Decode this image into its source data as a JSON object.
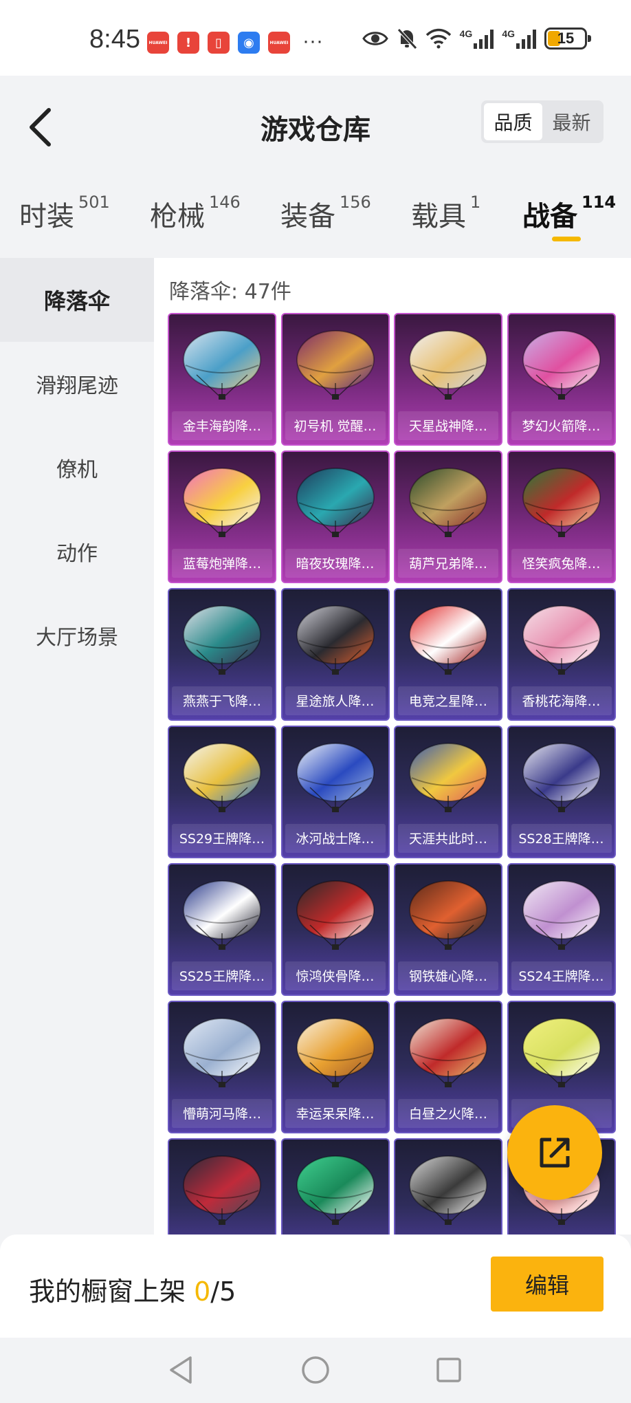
{
  "status_bar": {
    "time": "8:45",
    "notifications": [
      {
        "icon": "huawei-app-icon",
        "color": "red",
        "text": "HUAWEI"
      },
      {
        "icon": "alert-app-icon",
        "color": "red",
        "text": "!"
      },
      {
        "icon": "book-app-icon",
        "color": "red",
        "text": "▯"
      },
      {
        "icon": "bulb-app-icon",
        "color": "blue",
        "text": "◉"
      },
      {
        "icon": "huawei-app-icon",
        "color": "red",
        "text": "HUAWEI"
      }
    ],
    "more": "···",
    "signal_1": "4G",
    "signal_2": "4G",
    "battery": "15"
  },
  "header": {
    "title": "游戏仓库",
    "sort_options": [
      "品质",
      "最新"
    ],
    "active_sort": 0
  },
  "tabs": [
    {
      "label": "时装",
      "count": "501"
    },
    {
      "label": "枪械",
      "count": "146"
    },
    {
      "label": "装备",
      "count": "156"
    },
    {
      "label": "载具",
      "count": "1"
    },
    {
      "label": "战备",
      "count": "114"
    }
  ],
  "active_tab": 4,
  "sidebar": {
    "items": [
      "降落伞",
      "滑翔尾迹",
      "僚机",
      "动作",
      "大厅场景"
    ],
    "active": 0
  },
  "content": {
    "count_label": "降落伞: 47件",
    "items": [
      {
        "name": "金丰海韵降…",
        "tier": "purple"
      },
      {
        "name": "初号机 觉醒…",
        "tier": "purple"
      },
      {
        "name": "天星战神降…",
        "tier": "purple"
      },
      {
        "name": "梦幻火箭降…",
        "tier": "purple"
      },
      {
        "name": "蓝莓炮弹降…",
        "tier": "purple"
      },
      {
        "name": "暗夜玫瑰降…",
        "tier": "purple"
      },
      {
        "name": "葫芦兄弟降…",
        "tier": "purple"
      },
      {
        "name": "怪笑疯兔降…",
        "tier": "purple"
      },
      {
        "name": "燕燕于飞降…",
        "tier": "blue"
      },
      {
        "name": "星途旅人降…",
        "tier": "blue"
      },
      {
        "name": "电竞之星降…",
        "tier": "blue"
      },
      {
        "name": "香桃花海降…",
        "tier": "blue"
      },
      {
        "name": "SS29王牌降…",
        "tier": "blue"
      },
      {
        "name": "冰河战士降…",
        "tier": "blue"
      },
      {
        "name": "天涯共此时…",
        "tier": "blue"
      },
      {
        "name": "SS28王牌降…",
        "tier": "blue"
      },
      {
        "name": "SS25王牌降…",
        "tier": "blue"
      },
      {
        "name": "惊鸿侠骨降…",
        "tier": "blue"
      },
      {
        "name": "钢铁雄心降…",
        "tier": "blue"
      },
      {
        "name": "SS24王牌降…",
        "tier": "blue"
      },
      {
        "name": "懵萌河马降…",
        "tier": "blue"
      },
      {
        "name": "幸运呆呆降…",
        "tier": "blue"
      },
      {
        "name": "白昼之火降…",
        "tier": "blue"
      },
      {
        "name": "日…降…",
        "tier": "blue"
      },
      {
        "name": "",
        "tier": "blue"
      },
      {
        "name": "",
        "tier": "blue"
      },
      {
        "name": "",
        "tier": "blue"
      },
      {
        "name": "",
        "tier": "blue"
      }
    ],
    "canopy_colors": [
      [
        "#d8e4ee",
        "#4b9fc8",
        "#e8c88a"
      ],
      [
        "#7a2a6a",
        "#e0a040",
        "#5a2a80"
      ],
      [
        "#f0f0f4",
        "#e8c070",
        "#cfd4e0"
      ],
      [
        "#c8b0e8",
        "#e050a0",
        "#f4e8f0"
      ],
      [
        "#f070c0",
        "#f8d040",
        "#f4f0f8"
      ],
      [
        "#1e3a5a",
        "#2aa8b0",
        "#3b2a4a"
      ],
      [
        "#2a4a2a",
        "#c0a060",
        "#8a2a2a"
      ],
      [
        "#2a7a3a",
        "#c02a2a",
        "#f0d0a0"
      ],
      [
        "#e0e0e8",
        "#2a8a8a",
        "#3a2a4a"
      ],
      [
        "#d0d0d8",
        "#2a2a30",
        "#e06030"
      ],
      [
        "#e02a2a",
        "#ffffff",
        "#a01a1a"
      ],
      [
        "#f4e0e8",
        "#e890b0",
        "#ffffff"
      ],
      [
        "#f4f4f0",
        "#e8c040",
        "#3a7ad0"
      ],
      [
        "#f0f4f8",
        "#2a4ac0",
        "#a0b8e0"
      ],
      [
        "#3a5ab0",
        "#f0c840",
        "#e05a5a"
      ],
      [
        "#e8e8f0",
        "#3a3a8a",
        "#ffffff"
      ],
      [
        "#2a3a8a",
        "#ffffff",
        "#1a1a2a"
      ],
      [
        "#2a2a2a",
        "#c02a2a",
        "#ffffff"
      ],
      [
        "#5a2a1a",
        "#e06030",
        "#2a2a2a"
      ],
      [
        "#f0e8f4",
        "#c090d0",
        "#ffffff"
      ],
      [
        "#e0e8f4",
        "#9ab0d0",
        "#ffffff"
      ],
      [
        "#f8f0e0",
        "#e8a030",
        "#a05a2a"
      ],
      [
        "#f0e8d8",
        "#c02a2a",
        "#e8c070"
      ],
      [
        "#f0f080",
        "#d8e060",
        "#ffffff"
      ],
      [
        "#2a2a3a",
        "#c02a3a",
        "#4a4a5a"
      ],
      [
        "#40d090",
        "#1a8a5a",
        "#ffffff"
      ],
      [
        "#d8d8d8",
        "#3a3a3a",
        "#ffffff"
      ],
      [
        "#f8d8d8",
        "#f0a0a0",
        "#ffffff"
      ]
    ]
  },
  "bottom_bar": {
    "showcase_prefix": "我的橱窗上架 ",
    "showcase_current": "0",
    "showcase_total": "/5",
    "edit_label": "编辑"
  }
}
